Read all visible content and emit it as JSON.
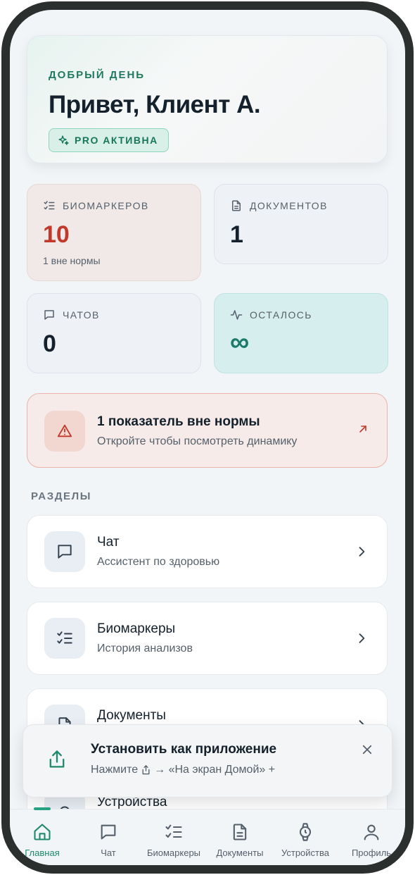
{
  "greeting": {
    "eyebrow": "ДОБРЫЙ ДЕНЬ",
    "title": "Привет, Клиент А.",
    "badge": "PRO АКТИВНА"
  },
  "stats": {
    "biomarkers": {
      "label": "БИОМАРКЕРОВ",
      "value": "10",
      "sub": "1 вне нормы"
    },
    "documents": {
      "label": "ДОКУМЕНТОВ",
      "value": "1"
    },
    "chats": {
      "label": "ЧАТОВ",
      "value": "0"
    },
    "remaining": {
      "label": "ОСТАЛОСЬ",
      "value": "∞"
    }
  },
  "alert": {
    "title": "1 показатель вне нормы",
    "subtitle": "Откройте чтобы посмотреть динамику"
  },
  "sections": {
    "label": "РАЗДЕЛЫ",
    "items": [
      {
        "title": "Чат",
        "subtitle": "Ассистент по здоровью"
      },
      {
        "title": "Биомаркеры",
        "subtitle": "История анализов"
      },
      {
        "title": "Документы",
        "subtitle": ""
      },
      {
        "title": "Устройства",
        "subtitle": ""
      }
    ]
  },
  "install": {
    "title": "Установить как приложение",
    "sub_prefix": "Нажмите",
    "sub_suffix": "→ «На экран Домой» +"
  },
  "tabs": [
    {
      "label": "Главная",
      "icon": "home-icon",
      "active": true
    },
    {
      "label": "Чат",
      "icon": "chat-icon"
    },
    {
      "label": "Биомаркеры",
      "icon": "checklist-icon"
    },
    {
      "label": "Документы",
      "icon": "document-icon"
    },
    {
      "label": "Устройства",
      "icon": "watch-icon"
    },
    {
      "label": "Профиль",
      "icon": "person-icon"
    }
  ],
  "colors": {
    "accent": "#1f8a6b",
    "alert": "#c0392b",
    "background": "#f2f5f8"
  }
}
